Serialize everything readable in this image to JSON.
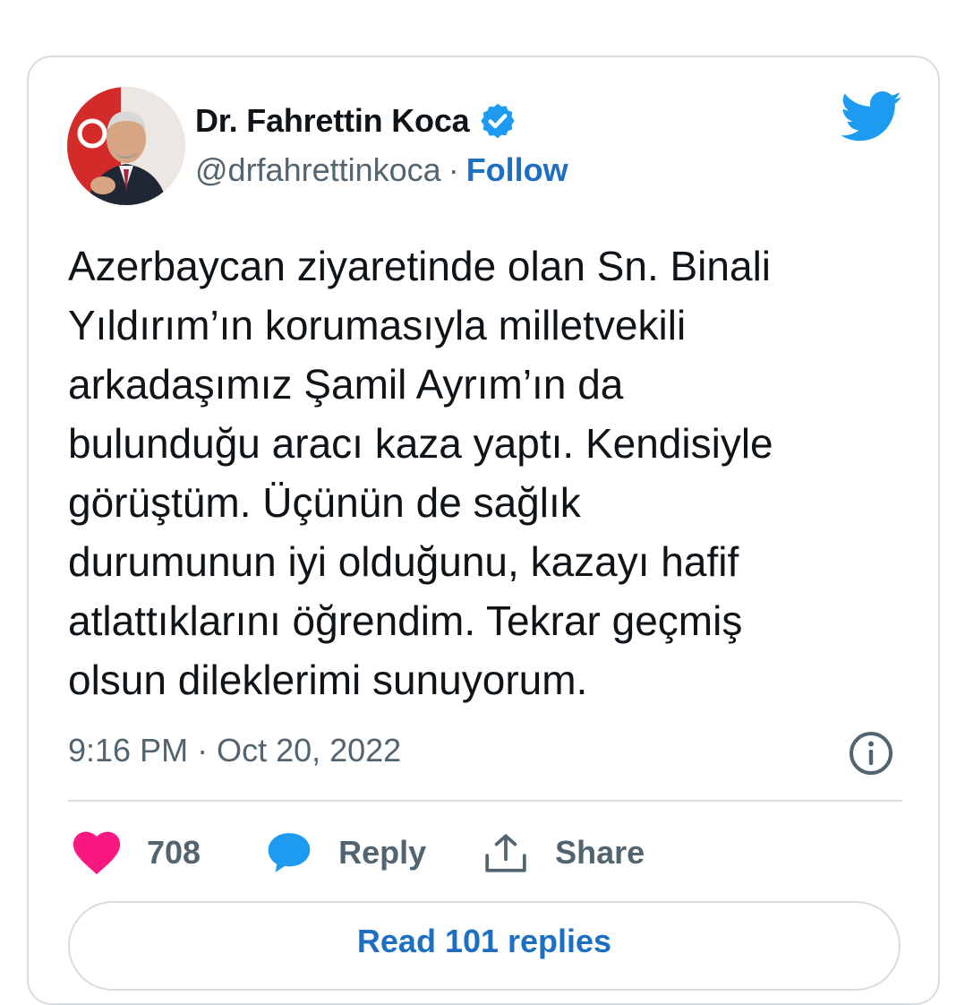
{
  "author": {
    "name": "Dr. Fahrettin Koca",
    "handle": "@drfahrettinkoca",
    "separator": "·",
    "follow_label": "Follow"
  },
  "tweet": {
    "text": "Azerbaycan ziyaretinde olan Sn. Binali\nYıldırım’ın korumasıyla milletvekili\narkadaşımız Şamil Ayrım’ın da\nbulunduğu aracı kaza yaptı. Kendisiyle\ngörüştüm. Üçünün de sağlık\ndurumunun iyi olduğunu, kazayı hafif\natlattıklarını öğrendim. Tekrar geçmiş\nolsun dileklerimi sunuyorum.",
    "timestamp": "9:16 PM · Oct 20, 2022"
  },
  "actions": {
    "like_count": "708",
    "reply_label": "Reply",
    "share_label": "Share"
  },
  "read_replies_label": "Read 101 replies",
  "icons": {
    "verified": "verified-badge-icon",
    "twitter": "twitter-bird-icon",
    "info": "info-icon",
    "like": "heart-icon",
    "reply": "speech-bubble-icon",
    "share": "share-upload-icon"
  },
  "colors": {
    "accent": "#1d6fc4",
    "twitter_blue": "#1d9bf0",
    "like": "#f91880",
    "secondary_text": "#536471",
    "border": "#d6dde2"
  }
}
